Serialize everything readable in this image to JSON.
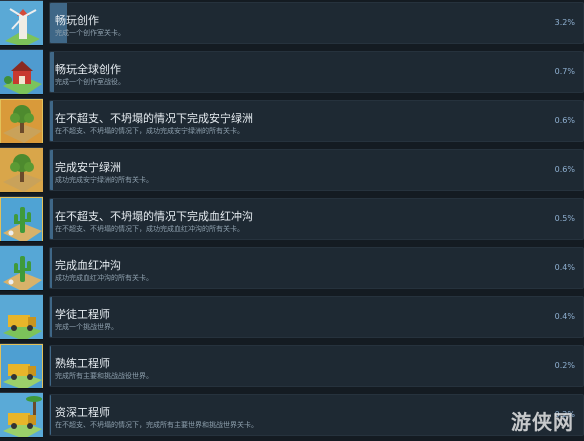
{
  "achievements": [
    {
      "title": "畅玩创作",
      "desc": "完成一个创作室关卡。",
      "percent": "3.2%",
      "icon": "windmill-icon",
      "icon_bg": "#5aa9d6"
    },
    {
      "title": "畅玩全球创作",
      "desc": "完成一个创作室战役。",
      "percent": "0.7%",
      "icon": "barn-icon",
      "icon_bg": "#4f9bd0"
    },
    {
      "title": "在不超支、不坍塌的情况下完成安宁绿洲",
      "desc": "在不超支、不坍塌的情况下，成功完成安宁绿洲的所有关卡。",
      "percent": "0.6%",
      "icon": "tree-gold-icon",
      "icon_bg": "#d99a3a"
    },
    {
      "title": "完成安宁绿洲",
      "desc": "成功完成安宁绿洲的所有关卡。",
      "percent": "0.6%",
      "icon": "tree-icon",
      "icon_bg": "#d9a64a"
    },
    {
      "title": "在不超支、不坍塌的情况下完成血红冲沟",
      "desc": "在不超支、不坍塌的情况下，成功完成血红冲沟的所有关卡。",
      "percent": "0.5%",
      "icon": "cactus-gold-icon",
      "icon_bg": "#4fa3d4"
    },
    {
      "title": "完成血红冲沟",
      "desc": "成功完成血红冲沟的所有关卡。",
      "percent": "0.4%",
      "icon": "cactus-icon",
      "icon_bg": "#56a7d6"
    },
    {
      "title": "学徒工程师",
      "desc": "完成一个挑战世界。",
      "percent": "0.4%",
      "icon": "truck-icon",
      "icon_bg": "#5aa9d6"
    },
    {
      "title": "熟练工程师",
      "desc": "完成所有主要和挑战战役世界。",
      "percent": "0.2%",
      "icon": "truck-gold-icon",
      "icon_bg": "#4e9fd2"
    },
    {
      "title": "资深工程师",
      "desc": "在不超支、不坍塌的情况下，完成所有主要世界和挑战世界关卡。",
      "percent": "0.2%",
      "icon": "truck-palm-icon",
      "icon_bg": "#5aaad7"
    }
  ],
  "watermark": "游侠网"
}
